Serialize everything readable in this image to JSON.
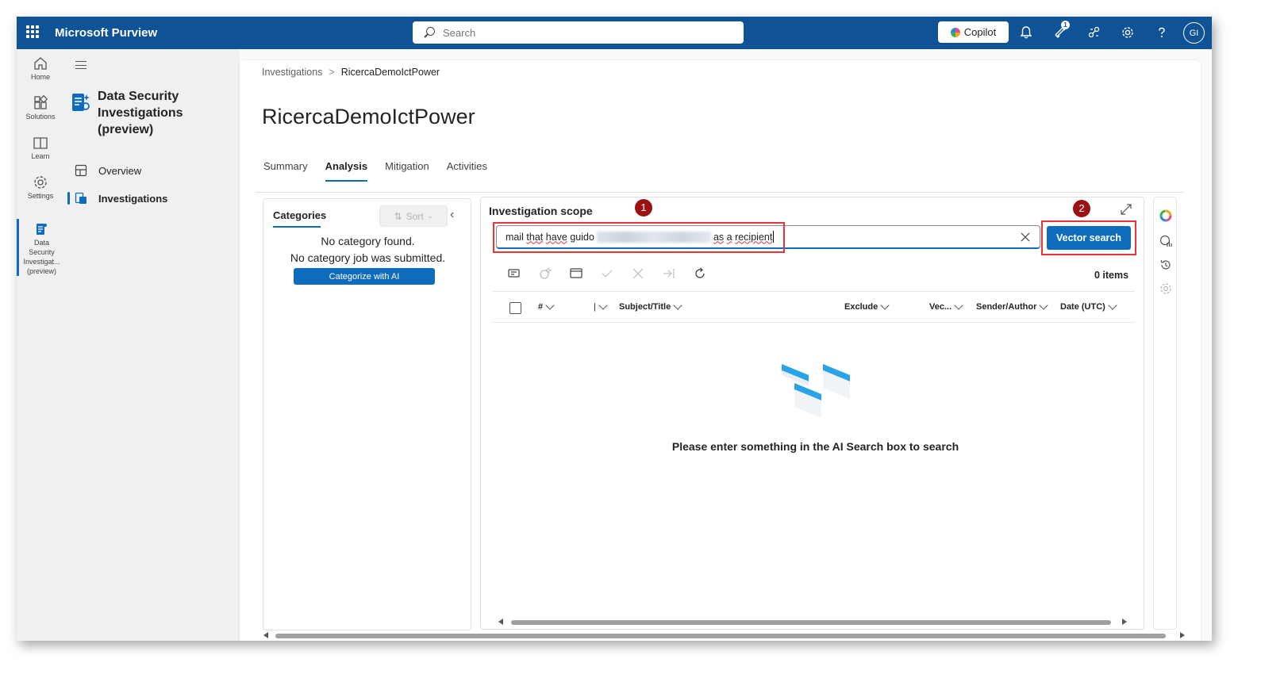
{
  "header": {
    "app_title": "Microsoft Purview",
    "search_placeholder": "Search",
    "copilot_label": "Copilot",
    "notification_count": "1",
    "avatar_initials": "GI"
  },
  "rail": {
    "items": [
      {
        "label": "Home",
        "icon": "home-icon"
      },
      {
        "label": "Solutions",
        "icon": "solutions-icon"
      },
      {
        "label": "Learn",
        "icon": "learn-icon"
      },
      {
        "label": "Settings",
        "icon": "settings-icon"
      }
    ],
    "active_label_lines": [
      "Data",
      "Security",
      "Investigat...",
      "(preview)"
    ]
  },
  "subnav": {
    "title": "Data Security Investigations (preview)",
    "items": [
      {
        "label": "Overview",
        "icon": "overview-icon"
      },
      {
        "label": "Investigations",
        "icon": "investigations-icon"
      }
    ]
  },
  "breadcrumb": {
    "parent": "Investigations",
    "separator": ">",
    "current": "RicercaDemoIctPower"
  },
  "page": {
    "title": "RicercaDemoIctPower",
    "tabs": [
      {
        "label": "Summary",
        "active": false
      },
      {
        "label": "Analysis",
        "active": true
      },
      {
        "label": "Mitigation",
        "active": false
      },
      {
        "label": "Activities",
        "active": false
      }
    ]
  },
  "categories": {
    "label": "Categories",
    "sort_label": "Sort",
    "empty_line1": "No category found.",
    "empty_line2": "No category job was submitted.",
    "categorize_button": "Categorize with AI"
  },
  "scope": {
    "title": "Investigation scope",
    "query_words": [
      "mail",
      "that",
      "have",
      "guido"
    ],
    "query_suffix_words": [
      "as",
      "a",
      "recipient"
    ],
    "search_button": "Vector search",
    "items_count": "0 items",
    "callouts": [
      "1",
      "2"
    ],
    "columns": [
      "#",
      "|",
      "Subject/Title",
      "Exclude",
      "Vec...",
      "Sender/Author",
      "Date (UTC)"
    ],
    "empty_message": "Please enter something in the AI Search box to search"
  },
  "colors": {
    "topbar": "#0f5296",
    "accent": "#0f6cbd",
    "highlight_box": "#e8343a",
    "callout": "#9b1114"
  }
}
